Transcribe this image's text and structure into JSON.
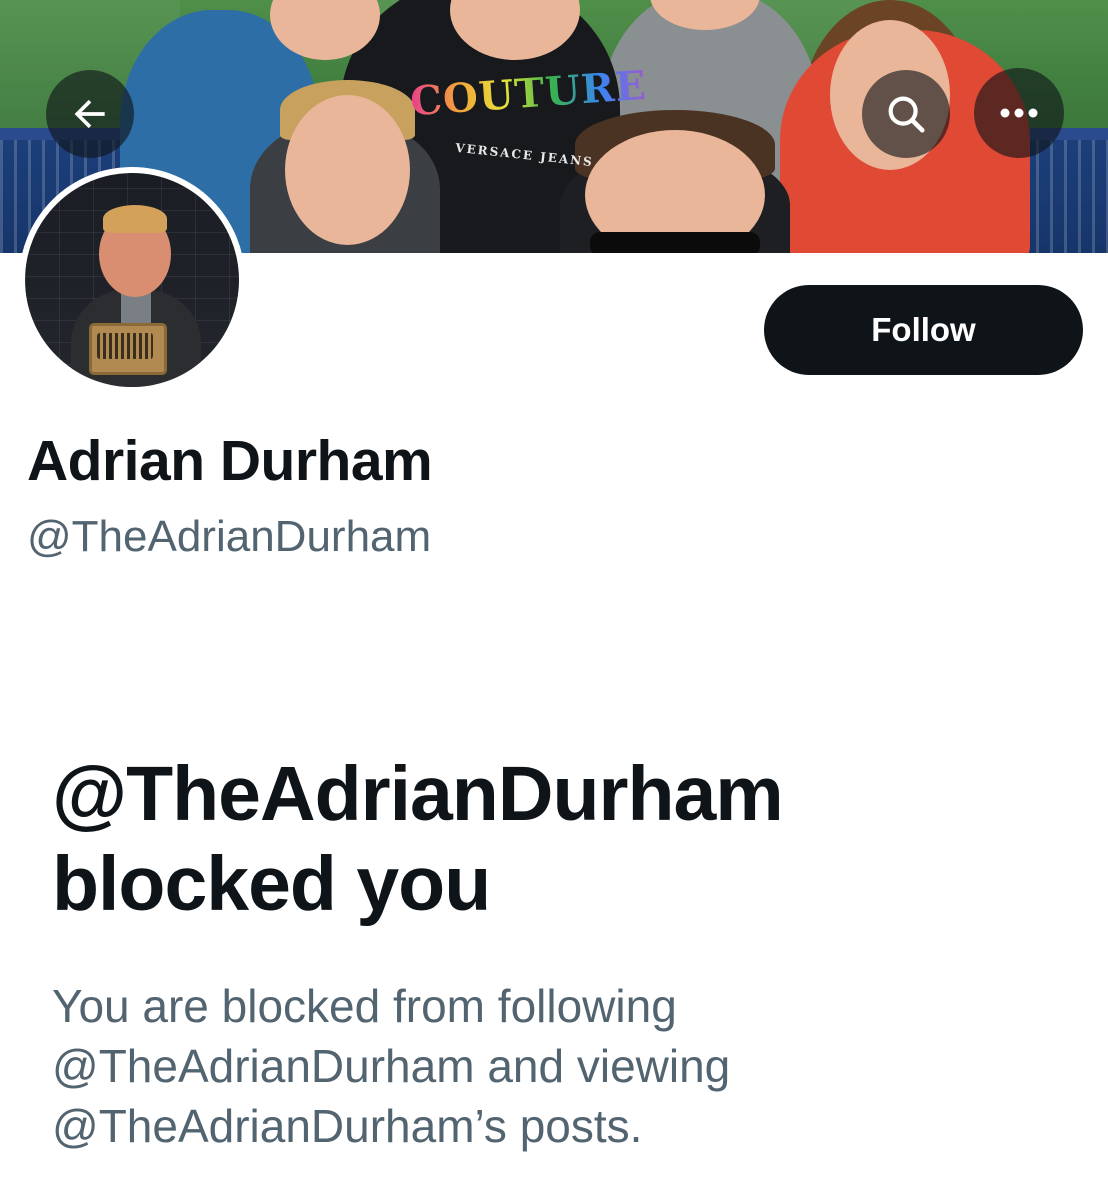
{
  "banner": {
    "image_text": "COUTURE",
    "image_subtext": "VERSACE JEANS"
  },
  "icons": {
    "back": "arrow-left-icon",
    "search": "search-icon",
    "more": "more-horizontal-icon"
  },
  "profile": {
    "display_name": "Adrian Durham",
    "handle": "@TheAdrianDurham",
    "follow_label": "Follow"
  },
  "blocked": {
    "title_line1": "@TheAdrianDurham",
    "title_line2": "blocked you",
    "desc_line1": "You are blocked from following",
    "desc_line2": "@TheAdrianDurham and viewing",
    "desc_line3": "@TheAdrianDurham’s posts."
  },
  "colors": {
    "text_primary": "#0f1419",
    "text_secondary": "#536471",
    "button_bg": "#0f1419",
    "button_text": "#ffffff",
    "overlay": "rgba(15,20,25,0.62)"
  }
}
